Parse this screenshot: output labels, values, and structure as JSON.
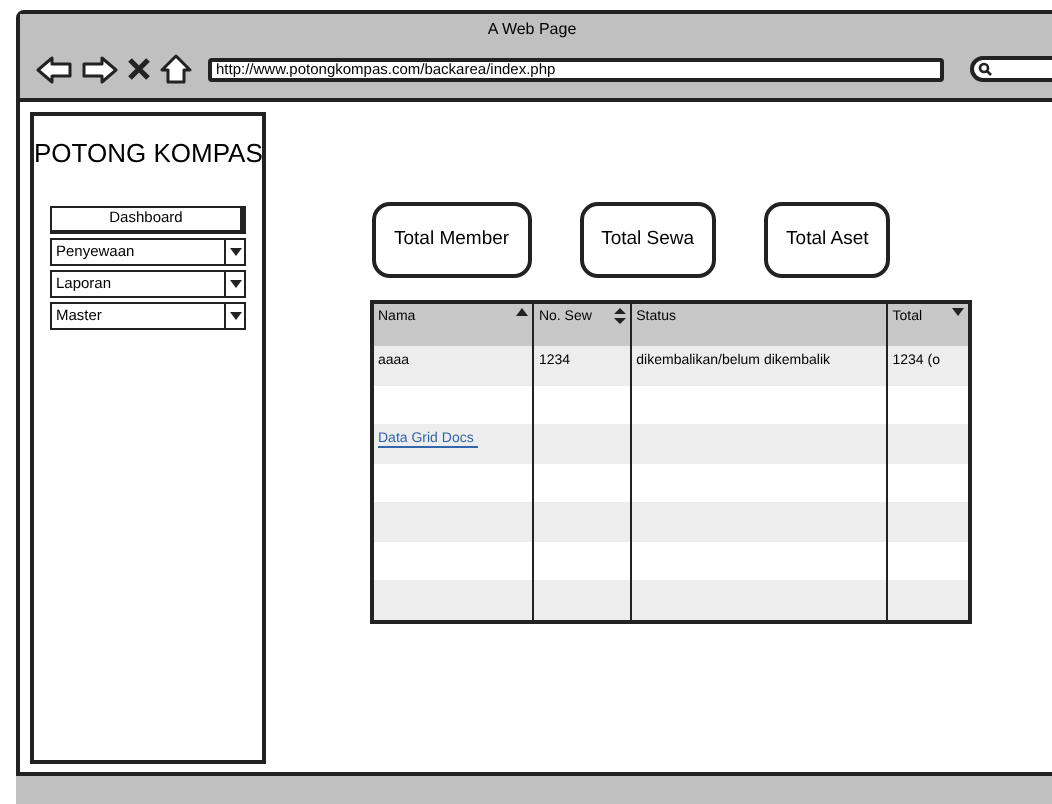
{
  "window": {
    "title": "A Web Page",
    "url": "http://www.potongkompas.com/backarea/index.php"
  },
  "sidebar": {
    "brand": "POTONG KOMPAS",
    "items": [
      {
        "label": "Dashboard",
        "kind": "button"
      },
      {
        "label": "Penyewaan",
        "kind": "dropdown"
      },
      {
        "label": "Laporan",
        "kind": "dropdown"
      },
      {
        "label": "Master",
        "kind": "dropdown"
      }
    ]
  },
  "cards": [
    "Total Member",
    "Total Sewa",
    "Total Aset"
  ],
  "table": {
    "columns": [
      {
        "label": "Nama",
        "sort_up": true,
        "sort_down": false
      },
      {
        "label": "No. Sew",
        "sort_up": true,
        "sort_down": true
      },
      {
        "label": "Status",
        "sort_up": false,
        "sort_down": false
      },
      {
        "label": "Total",
        "sort_up": false,
        "sort_down": true
      }
    ],
    "rows": [
      {
        "cells": [
          {
            "text": "aaaa",
            "kind": "text"
          },
          {
            "text": "1234",
            "kind": "text"
          },
          {
            "text": "dikembalikan/belum dikembalik",
            "kind": "text"
          },
          {
            "text": "1234 (o",
            "kind": "text"
          }
        ]
      },
      {
        "cells": []
      },
      {
        "cells": [
          {
            "text": "Data Grid Docs",
            "kind": "link"
          }
        ]
      },
      {
        "cells": []
      },
      {
        "cells": []
      },
      {
        "cells": []
      },
      {
        "cells": []
      }
    ]
  }
}
